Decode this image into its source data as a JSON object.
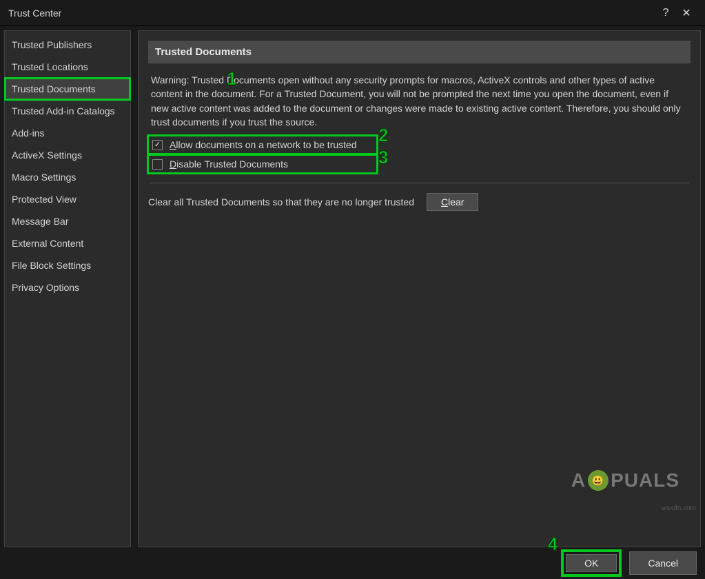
{
  "titlebar": {
    "title": "Trust Center",
    "help": "?",
    "close": "✕"
  },
  "sidebar": {
    "items": [
      {
        "label": "Trusted Publishers"
      },
      {
        "label": "Trusted Locations"
      },
      {
        "label": "Trusted Documents",
        "selected": true
      },
      {
        "label": "Trusted Add-in Catalogs"
      },
      {
        "label": "Add-ins"
      },
      {
        "label": "ActiveX Settings"
      },
      {
        "label": "Macro Settings"
      },
      {
        "label": "Protected View"
      },
      {
        "label": "Message Bar"
      },
      {
        "label": "External Content"
      },
      {
        "label": "File Block Settings"
      },
      {
        "label": "Privacy Options"
      }
    ]
  },
  "section": {
    "header": "Trusted Documents",
    "warning": "Warning: Trusted Documents open without any security prompts for macros, ActiveX controls and other types of active content in the document.  For a Trusted Document, you will not be prompted the next time you open the document, even if new active content was added to the document or changes were made to existing active content. Therefore, you should only trust documents if you trust the source.",
    "allow_label": "Allow documents on a network to be trusted",
    "disable_label": "Disable Trusted Documents",
    "clear_text": "Clear all Trusted Documents so that they are no longer trusted",
    "clear_button": "Clear"
  },
  "buttons": {
    "ok": "OK",
    "cancel": "Cancel"
  },
  "annotations": {
    "n1": "1",
    "n2": "2",
    "n3": "3",
    "n4": "4"
  },
  "watermark": {
    "part1": "A",
    "part2": "PUALS"
  },
  "wsx": "wsxdn.com"
}
